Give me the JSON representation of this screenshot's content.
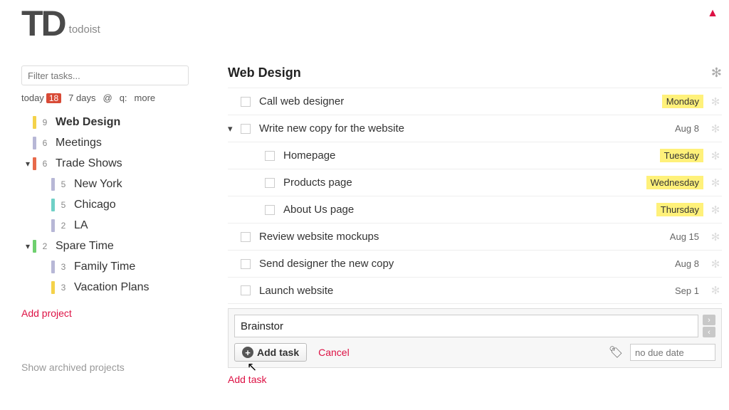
{
  "app": {
    "name": "todoist",
    "logo": "TD"
  },
  "alerts": {
    "warning_icon": "▲"
  },
  "sidebar": {
    "filter_placeholder": "Filter tasks...",
    "quick_filters": {
      "today": "today",
      "today_count": "18",
      "seven_days": "7 days",
      "at": "@",
      "q": "q:",
      "more": "more"
    },
    "projects": [
      {
        "name": "Web Design",
        "count": "9",
        "color": "#f4d24a",
        "selected": true
      },
      {
        "name": "Meetings",
        "count": "6",
        "color": "#b7b7d6"
      },
      {
        "name": "Trade Shows",
        "count": "6",
        "color": "#e86a4a",
        "expanded": true,
        "children": [
          {
            "name": "New York",
            "count": "5",
            "color": "#b7b7d6"
          },
          {
            "name": "Chicago",
            "count": "5",
            "color": "#6fd0c6"
          },
          {
            "name": "LA",
            "count": "2",
            "color": "#b7b7d6"
          }
        ]
      },
      {
        "name": "Spare Time",
        "count": "2",
        "color": "#6fd06f",
        "expanded": true,
        "children": [
          {
            "name": "Family Time",
            "count": "3",
            "color": "#b7b7d6"
          },
          {
            "name": "Vacation Plans",
            "count": "3",
            "color": "#f4d24a"
          }
        ]
      }
    ],
    "add_project": "Add project",
    "archived": "Show archived projects"
  },
  "main": {
    "title": "Web Design",
    "tasks": [
      {
        "name": "Call web designer",
        "due": "Monday",
        "highlight": true
      },
      {
        "name": "Write new copy for the website",
        "due": "Aug 8",
        "expanded": true,
        "children": [
          {
            "name": "Homepage",
            "due": "Tuesday",
            "highlight": true
          },
          {
            "name": "Products page",
            "due": "Wednesday",
            "highlight": true
          },
          {
            "name": "About Us page",
            "due": "Thursday",
            "highlight": true
          }
        ]
      },
      {
        "name": "Review website mockups",
        "due": "Aug 15"
      },
      {
        "name": "Send designer the new copy",
        "due": "Aug 8"
      },
      {
        "name": "Launch website",
        "due": "Sep 1"
      }
    ],
    "add_panel": {
      "input_value": "Brainstor",
      "add_button": "Add task",
      "cancel": "Cancel",
      "due_placeholder": "no due date"
    },
    "add_task_link": "Add task"
  }
}
